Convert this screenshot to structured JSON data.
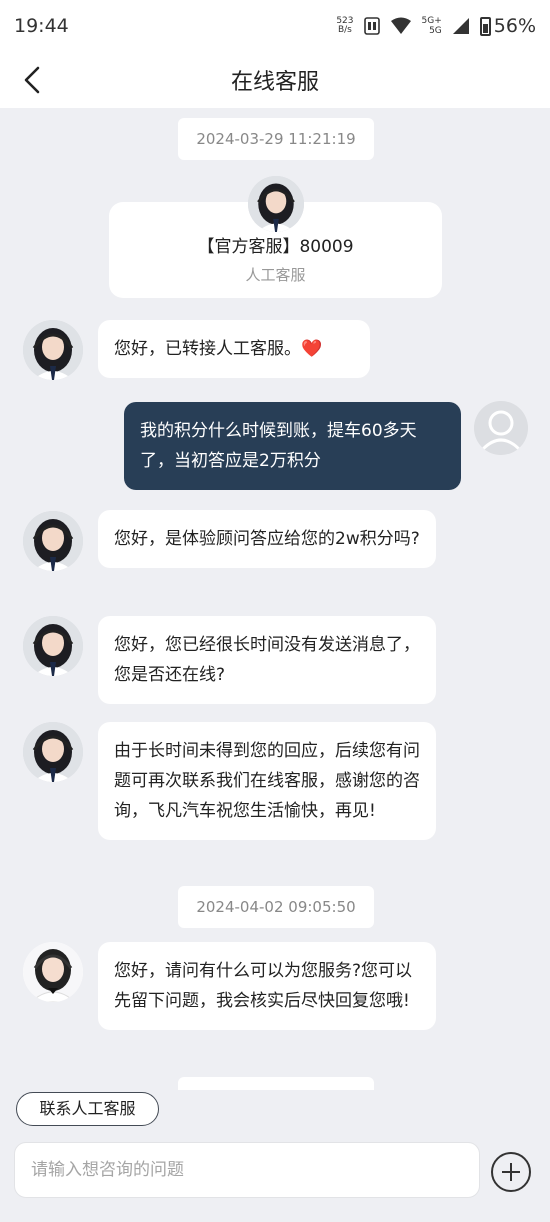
{
  "status_bar": {
    "time": "19:44",
    "net_speed_value": "523",
    "net_speed_unit": "B/s",
    "signal_top": "5G+",
    "signal_bottom": "5G",
    "battery": "56%"
  },
  "header": {
    "title": "在线客服"
  },
  "chat": {
    "timestamp_1": "2024-03-29 11:21:19",
    "agent_card": {
      "name": "【官方客服】80009",
      "role": "人工客服"
    },
    "messages": [
      {
        "from": "agent",
        "text": "您好，已转接人工客服。❤️"
      },
      {
        "from": "user",
        "text": "我的积分什么时候到账，提车60多天了，当初答应是2万积分"
      },
      {
        "from": "agent",
        "text": "您好，是体验顾问答应给您的2w积分吗?"
      },
      {
        "from": "agent",
        "text": "您好，您已经很长时间没有发送消息了，您是否还在线?"
      },
      {
        "from": "agent",
        "text": "由于长时间未得到您的回应，后续您有问题可再次联系我们在线客服，感谢您的咨询，飞凡汽车祝您生活愉快，再见!"
      }
    ],
    "timestamp_2": "2024-04-02 09:05:50",
    "bot_message": "您好，请问有什么可以为您服务?您可以先留下问题，我会核实后尽快回复您哦!"
  },
  "footer": {
    "contact_button": "联系人工客服",
    "input_placeholder": "请输入想咨询的问题"
  },
  "colors": {
    "user_bubble": "#283e56",
    "background": "#eeeff3"
  }
}
